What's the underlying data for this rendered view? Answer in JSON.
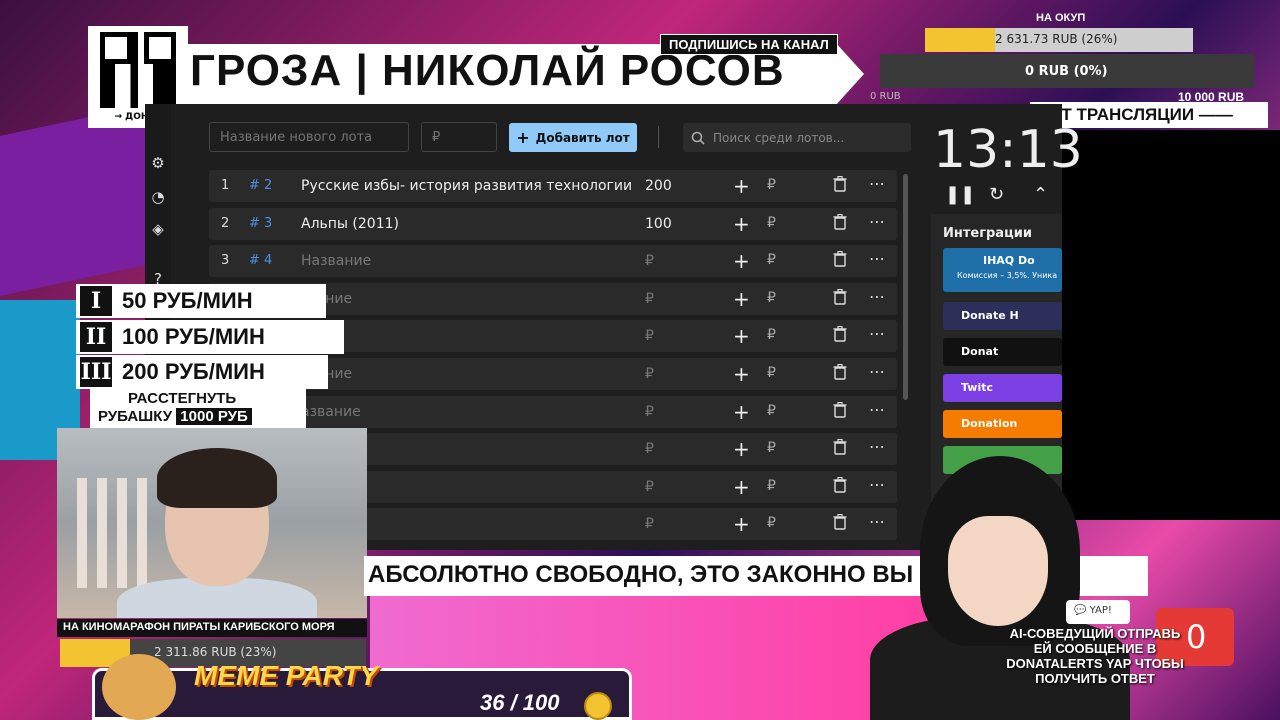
{
  "qr": {
    "label": "→ ДОНАТ"
  },
  "banner": {
    "title": "ГРОЗА | НИКОЛАЙ РОСОВ",
    "subscribe": "ПОДПИШИСЬ НА КАНАЛ"
  },
  "goal": {
    "label": "НА ОКУП",
    "bar1_text": "2 631.73 RUB (26%)",
    "bar1_fraction": 0.26,
    "bar2_text": "0 RUB (0%)",
    "small_rub": "0 RUB",
    "target": "10 000 RUB"
  },
  "chat": {
    "label": "ЧАТ ТРАНСЛЯЦИИ"
  },
  "app": {
    "lot_placeholder": "Название нового лота",
    "price_placeholder": "₽",
    "add_label": "Добавить лот",
    "search_placeholder": "Поиск среди лотов...",
    "rows": [
      {
        "num": "1",
        "hash": "# 2",
        "name": "Русские избы- история развития технологии",
        "amount": "200"
      },
      {
        "num": "2",
        "hash": "# 3",
        "name": "Альпы (2011)",
        "amount": "100"
      },
      {
        "num": "3",
        "hash": "# 4",
        "name": "Название",
        "amount": "₽"
      },
      {
        "num": "",
        "hash": "",
        "name": "звание",
        "amount": "₽"
      },
      {
        "num": "",
        "hash": "",
        "name": "",
        "amount": "₽"
      },
      {
        "num": "",
        "hash": "",
        "name": "звание",
        "amount": "₽"
      },
      {
        "num": "",
        "hash": "",
        "name": "азвание",
        "amount": "₽"
      },
      {
        "num": "",
        "hash": "",
        "name": "",
        "amount": "₽"
      },
      {
        "num": "",
        "hash": "",
        "name": "",
        "amount": "₽"
      },
      {
        "num": "",
        "hash": "",
        "name": "",
        "amount": "₽"
      }
    ],
    "row_currency": "₽",
    "clock": "13:13",
    "integrations_title": "Интеграции",
    "integrations": [
      {
        "label": "IHAQ Do",
        "sub": "Комиссия – 3,5%. Уника",
        "color": "#1e6fa8"
      },
      {
        "label": "Donate H",
        "color": "#2b2f5a"
      },
      {
        "label": "Donat",
        "color": "#111111"
      },
      {
        "label": "Twitc",
        "color": "#7b3fe4"
      },
      {
        "label": "Donation",
        "color": "#f57c00"
      },
      {
        "label": "",
        "color": "#43a047"
      }
    ]
  },
  "tiers": [
    {
      "icon": "I",
      "text": "50 РУБ/МИН"
    },
    {
      "icon": "II",
      "text": "100 РУБ/МИН"
    },
    {
      "icon": "III",
      "text": "200 РУБ/МИН"
    }
  ],
  "shirt": {
    "line1": "РАССТЕГНУТЬ",
    "line2": "РУБАШКУ",
    "price": "1000 РУБ"
  },
  "cam": {
    "caption": "НА КИНОМАРАФОН ПИРАТЫ КАРИБСКОГО МОРЯ",
    "bar_text": "2 311.86 RUB (23%)",
    "bar_fraction": 0.23
  },
  "subtitle": "АБСОЛЮТНО СВОБОДНО, ЭТО ЗАКОННО ВЫ",
  "meme": {
    "title": "MEME PARTY",
    "count": "36 / 100"
  },
  "ai": {
    "yap": "YAP!",
    "text": "AI-СОВЕДУЩИЙ ОТПРАВЬ ЕЙ СООБЩЕНИЕ В DONATALERTS YAP ЧТОБЫ ПОЛУЧИТЬ ОТВЕТ",
    "badge": "0"
  }
}
